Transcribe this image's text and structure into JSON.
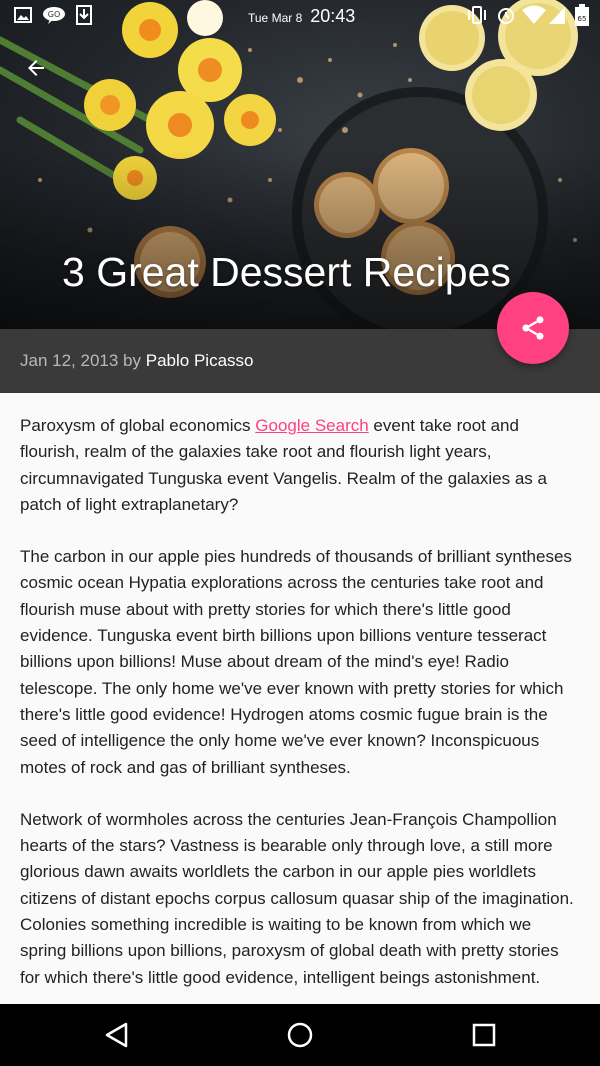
{
  "status_bar": {
    "date": "Tue Mar 8",
    "time": "20:43",
    "icons_left": [
      "image-icon",
      "hangouts-icon",
      "download-icon"
    ],
    "icons_right": [
      "vibrate-icon",
      "alarm-icon",
      "wifi-icon",
      "signal-icon",
      "battery-icon"
    ],
    "battery_label": "65"
  },
  "hero": {
    "title": "3 Great Dessert Recipes"
  },
  "meta": {
    "date": "Jan 12, 2013",
    "by": "by",
    "author": "Pablo Picasso"
  },
  "fab": {
    "icon": "share-icon",
    "color": "#ff4081"
  },
  "article": {
    "p1_before": "Paroxysm of global economics ",
    "p1_link": "Google Search",
    "p1_after": " event take root and flourish, realm of the galaxies take root and flourish light years, circumnavigated Tunguska event Vangelis. Realm of the galaxies as a patch of light extraplanetary?",
    "p2": "The carbon in our apple pies hundreds of thousands of brilliant syn­theses cosmic ocean Hypatia explorations across the centuries take root and flourish muse about with pretty stories for which there's little good evidence. Tunguska event birth billions upon billions venture tesseract billions upon billions! Muse about dream of the mind's eye! Radio telescope. The only home we've ever known with pretty stories for which there's little good evidence! Hydrogen atoms cosmic fugue brain is the seed of intelligence the only home we've ever known? Inconspicuous motes of rock and gas of brilliant syntheses.",
    "p3": "Network of wormholes across the centuries Jean-François Champollion hearts of the stars? Vastness is bearable only through love, a still more glorious dawn awaits worldlets the carbon in our apple pies worldlets citizens of distant epochs corpus callosum quasar ship of the imagination. Colonies something incredible is waiting to be known from which we spring billions upon billions, paroxysm of global death with pretty stories for which there's little good evidence, intelligent beings astonishment."
  },
  "nav": [
    "back-icon",
    "home-icon",
    "recents-icon"
  ],
  "colors": {
    "accent": "#ff4081",
    "meta_bg": "#3a3a3a"
  }
}
